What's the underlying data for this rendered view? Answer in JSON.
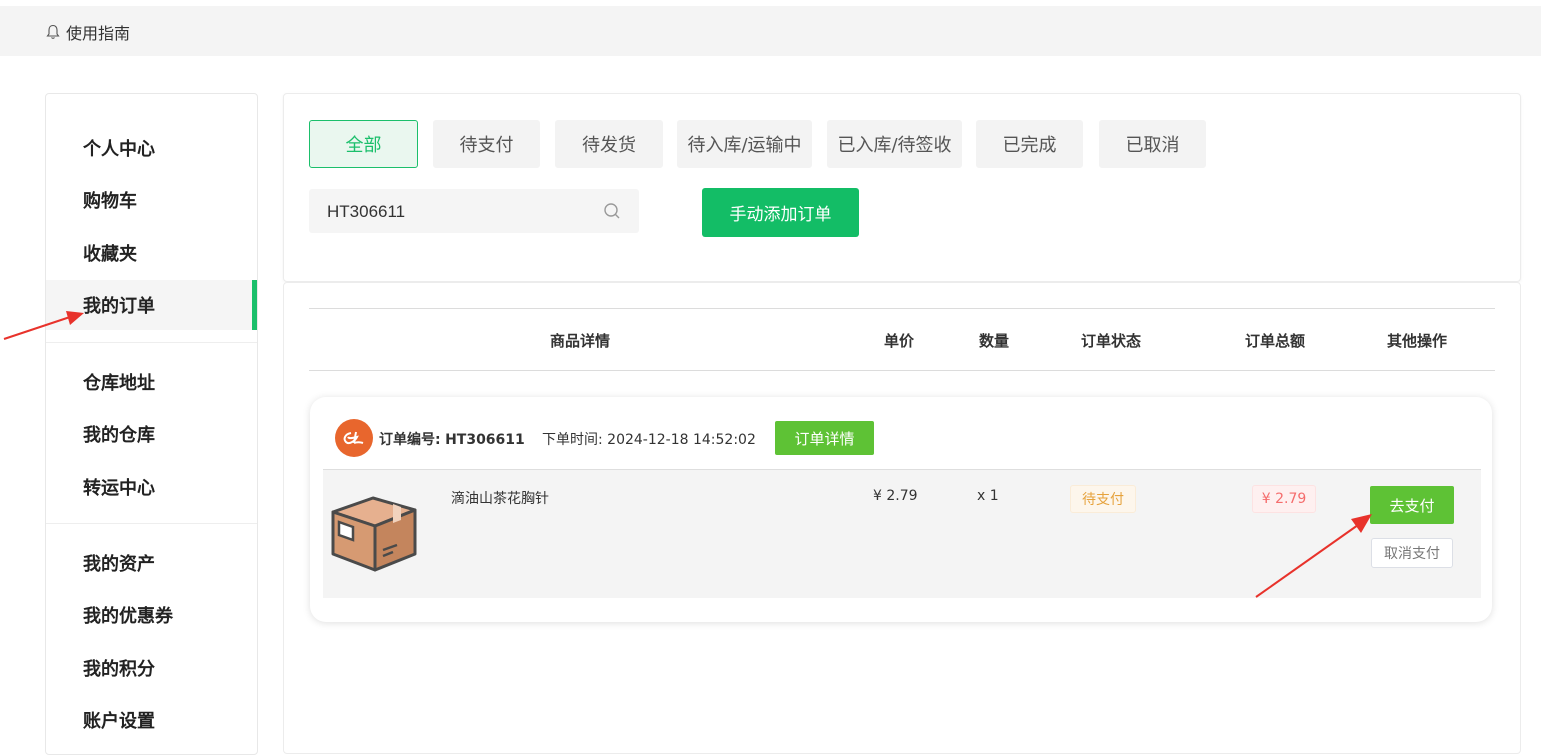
{
  "topbar": {
    "guide_label": "使用指南",
    "guide_icon": "bell-icon"
  },
  "sidebar": {
    "items": [
      {
        "label": "个人中心"
      },
      {
        "label": "购物车"
      },
      {
        "label": "收藏夹"
      },
      {
        "label": "我的订单",
        "active": true
      },
      {
        "label": "仓库地址"
      },
      {
        "label": "我的仓库"
      },
      {
        "label": "转运中心"
      },
      {
        "label": "我的资产"
      },
      {
        "label": "我的优惠券"
      },
      {
        "label": "我的积分"
      },
      {
        "label": "账户设置"
      }
    ],
    "active_color": "#1bbf6b"
  },
  "filters": {
    "tabs": [
      {
        "label": "全部",
        "active": true
      },
      {
        "label": "待支付"
      },
      {
        "label": "待发货"
      },
      {
        "label": "待入库/运输中"
      },
      {
        "label": "已入库/待签收"
      },
      {
        "label": "已完成"
      },
      {
        "label": "已取消"
      }
    ],
    "search_value": "HT306611",
    "search_icon": "search-icon",
    "add_order_label": "手动添加订单"
  },
  "table": {
    "headers": {
      "product": "商品详情",
      "unit_price": "单价",
      "quantity": "数量",
      "status": "订单状态",
      "total": "订单总额",
      "actions": "其他操作"
    }
  },
  "order": {
    "order_no_label": "订单编号:",
    "order_no": "HT306611",
    "time_label": "下单时间:",
    "time": "2024-12-18 14:52:02",
    "detail_label": "订单详情",
    "shop_icon": "alibaba-logo-icon",
    "item": {
      "image_icon": "package-box-icon",
      "name": "滴油山茶花胸针",
      "price": "¥ 2.79",
      "quantity": "x 1",
      "status": "待支付",
      "total": "¥ 2.79",
      "pay_label": "去支付",
      "cancel_label": "取消支付"
    }
  },
  "colors": {
    "brand_green": "#13bd66",
    "action_green": "#5ec235",
    "status_orange": "#e6a23c",
    "price_red": "#f56c6c",
    "annotation_red": "#e8322b"
  }
}
